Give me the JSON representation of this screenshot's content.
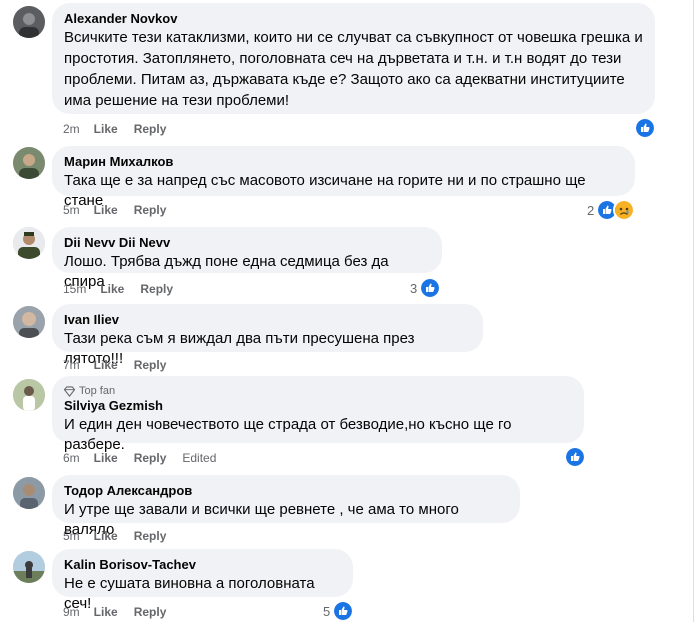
{
  "comments": [
    {
      "name": "Alexander Novkov",
      "lines": [
        "Всичките тези катаклизми, които ни се случват са съвкупност от човешка грешка и",
        "простотия. Затоплянето, поголовната сеч на дърветата и т.н. и т.н водят до тези",
        "проблеми. Питам аз, държавата къде е? Защото ако са адекватни институциите",
        "има решение на тези проблеми!"
      ],
      "time": "2m",
      "like": "Like",
      "reply": "Reply",
      "count": ""
    },
    {
      "name": "Марин Михалков",
      "lines": [
        "Така ще е за напред със масовото изсичане на горите ни и по страшно ще стане"
      ],
      "time": "5m",
      "like": "Like",
      "reply": "Reply",
      "count": "2"
    },
    {
      "name": "Dii Nevv Dii Nevv",
      "lines": [
        "Лошо. Трябва дъжд поне една седмица без да спира"
      ],
      "time": "15m",
      "like": "Like",
      "reply": "Reply",
      "count": "3"
    },
    {
      "name": "Ivan Iliev",
      "lines": [
        "Тази река съм я виждал два пъти пресушена през лятото!!!"
      ],
      "time": "7m",
      "like": "Like",
      "reply": "Reply",
      "count": ""
    },
    {
      "badge": "Top fan",
      "name": "Silviya Gezmish",
      "lines": [
        "И един ден човечеството ще страда от безводие,но късно ще го разбере."
      ],
      "time": "6m",
      "like": "Like",
      "reply": "Reply",
      "edited": "Edited",
      "count": ""
    },
    {
      "name": "Тодор Александров",
      "lines": [
        "И утре ще завали и всички ще ревнете , че ама то много валяло"
      ],
      "time": "5m",
      "like": "Like",
      "reply": "Reply",
      "count": ""
    },
    {
      "name": "Kalin Borisov-Tachev",
      "lines": [
        "Не е сушата виновна а поголовната сеч!"
      ],
      "time": "9m",
      "like": "Like",
      "reply": "Reply",
      "count": "5"
    }
  ],
  "colors": {
    "like_blue": "#1b74e4",
    "bubble": "#f0f2f5",
    "meta": "#65676b",
    "sad_yellow": "#f7b125"
  },
  "icons": {
    "like": "thumbs-up-icon",
    "sad": "sad-face-icon",
    "badge": "diamond-icon"
  }
}
